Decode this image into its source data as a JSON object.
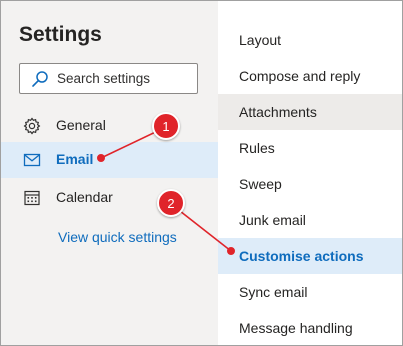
{
  "settings": {
    "title": "Settings",
    "search": {
      "placeholder": "Search settings",
      "icon": "search-icon"
    },
    "nav": [
      {
        "label": "General",
        "icon": "gear-icon"
      },
      {
        "label": "Email",
        "icon": "mail-icon",
        "selected": true
      },
      {
        "label": "Calendar",
        "icon": "calendar-icon"
      }
    ],
    "quick_settings_link": "View quick settings"
  },
  "email_options": [
    {
      "label": "Layout"
    },
    {
      "label": "Compose and reply"
    },
    {
      "label": "Attachments",
      "state": "hover"
    },
    {
      "label": "Rules"
    },
    {
      "label": "Sweep"
    },
    {
      "label": "Junk email"
    },
    {
      "label": "Customise actions",
      "state": "selected"
    },
    {
      "label": "Sync email"
    },
    {
      "label": "Message handling"
    }
  ],
  "callouts": [
    {
      "number": "1",
      "target": "Email"
    },
    {
      "number": "2",
      "target": "Customise actions"
    }
  ],
  "colors": {
    "accent": "#0f6cbd",
    "selected_bg": "#deecf9",
    "hover_bg": "#edebe9",
    "pane_bg": "#f3f2f1",
    "callout": "#e0242a"
  }
}
